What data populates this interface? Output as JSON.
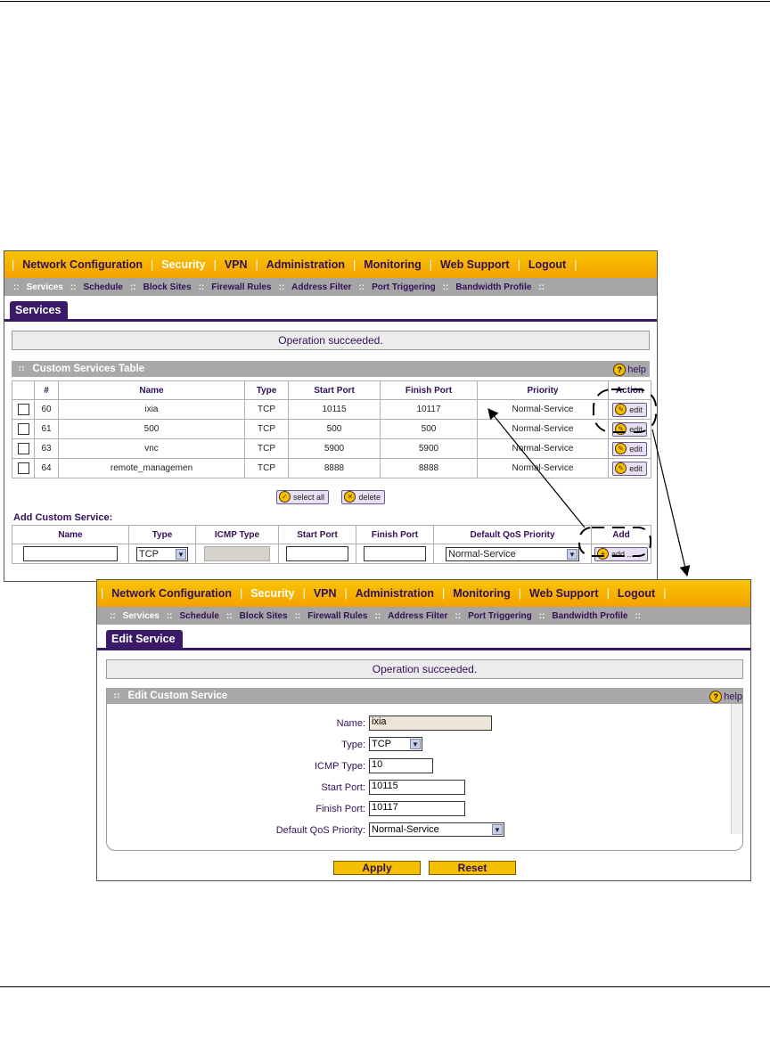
{
  "top_nav": [
    "Network Configuration",
    "Security",
    "VPN",
    "Administration",
    "Monitoring",
    "Web Support",
    "Logout"
  ],
  "sub_nav": [
    "Services",
    "Schedule",
    "Block Sites",
    "Firewall Rules",
    "Address Filter",
    "Port Triggering",
    "Bandwidth Profile"
  ],
  "services_screen": {
    "tab": "Services",
    "message": "Operation succeeded.",
    "section_title": "Custom Services Table",
    "help": "help",
    "columns": [
      "#",
      "Name",
      "Type",
      "Start Port",
      "Finish Port",
      "Priority",
      "Action"
    ],
    "rows": [
      {
        "num": "60",
        "name": "ixia",
        "type": "TCP",
        "start": "10115",
        "finish": "10117",
        "priority": "Normal-Service",
        "action": "edit"
      },
      {
        "num": "61",
        "name": "500",
        "type": "TCP",
        "start": "500",
        "finish": "500",
        "priority": "Normal-Service",
        "action": "edit"
      },
      {
        "num": "63",
        "name": "vnc",
        "type": "TCP",
        "start": "5900",
        "finish": "5900",
        "priority": "Normal-Service",
        "action": "edit"
      },
      {
        "num": "64",
        "name": "remote_managemen",
        "type": "TCP",
        "start": "8888",
        "finish": "8888",
        "priority": "Normal-Service",
        "action": "edit"
      }
    ],
    "select_all": "select all",
    "delete": "delete",
    "add_title": "Add Custom Service:",
    "add_columns": [
      "Name",
      "Type",
      "ICMP Type",
      "Start Port",
      "Finish Port",
      "Default QoS Priority",
      "Add"
    ],
    "add_type": "TCP",
    "add_priority": "Normal-Service",
    "add_button": "add ..."
  },
  "edit_screen": {
    "tab": "Edit Service",
    "message": "Operation succeeded.",
    "section_title": "Edit Custom Service",
    "help": "help",
    "fields": {
      "name_label": "Name:",
      "name_value": "ixia",
      "type_label": "Type:",
      "type_value": "TCP",
      "icmp_label": "ICMP Type:",
      "icmp_value": "10",
      "start_label": "Start Port:",
      "start_value": "10115",
      "finish_label": "Finish Port:",
      "finish_value": "10117",
      "qos_label": "Default QoS Priority:",
      "qos_value": "Normal-Service"
    },
    "apply": "Apply",
    "reset": "Reset"
  }
}
